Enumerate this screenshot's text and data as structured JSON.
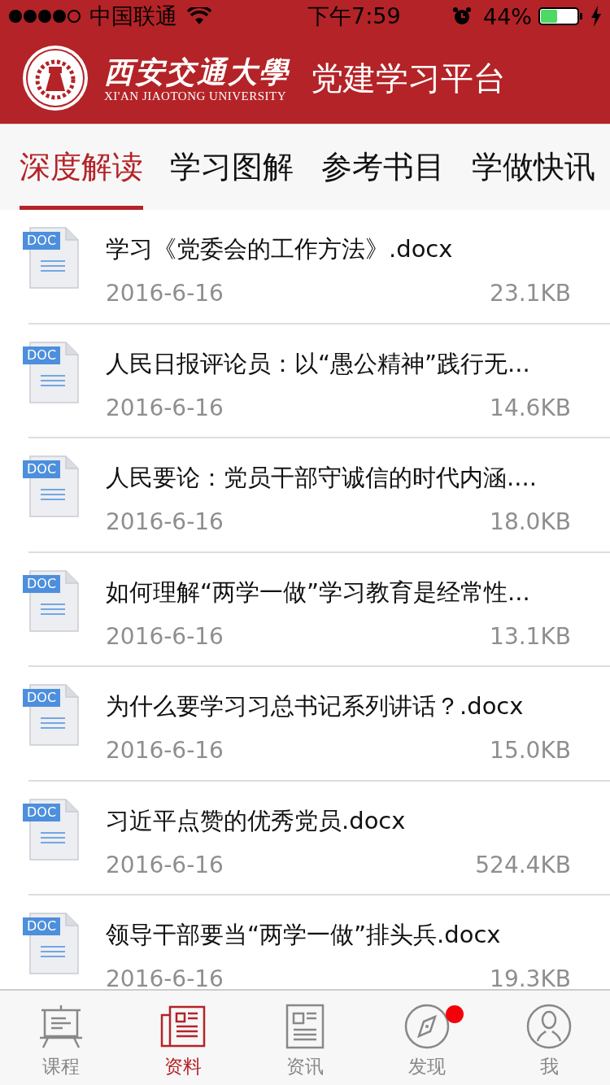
{
  "status_bar": {
    "carrier": "中国联通",
    "time": "下午7:59",
    "battery": "44%"
  },
  "header": {
    "logo_name": "西安交通大學",
    "logo_subtitle": "XI'AN JIAOTONG UNIVERSITY",
    "title": "党建学习平台"
  },
  "tabs": [
    {
      "label": "深度解读",
      "selected": true
    },
    {
      "label": "学习图解",
      "selected": false
    },
    {
      "label": "参考书目",
      "selected": false
    },
    {
      "label": "学做快讯",
      "selected": false
    }
  ],
  "files": [
    {
      "icon": "DOC",
      "name": "学习《党委会的工作方法》.docx",
      "date": "2016-6-16",
      "size": "23.1KB"
    },
    {
      "icon": "DOC",
      "name": "人民日报评论员：以“愚公精神”践行无...",
      "date": "2016-6-16",
      "size": "14.6KB"
    },
    {
      "icon": "DOC",
      "name": "人民要论：党员干部守诚信的时代内涵....",
      "date": "2016-6-16",
      "size": "18.0KB"
    },
    {
      "icon": "DOC",
      "name": "如何理解“两学一做”学习教育是经常性...",
      "date": "2016-6-16",
      "size": "13.1KB"
    },
    {
      "icon": "DOC",
      "name": "为什么要学习习总书记系列讲话？.docx",
      "date": "2016-6-16",
      "size": "15.0KB"
    },
    {
      "icon": "DOC",
      "name": "习近平点赞的优秀党员.docx",
      "date": "2016-6-16",
      "size": "524.4KB"
    },
    {
      "icon": "DOC",
      "name": "领导干部要当“两学一做”排头兵.docx",
      "date": "2016-6-16",
      "size": "19.3KB"
    }
  ],
  "tab_bar": [
    {
      "kind": "course",
      "label": "课程",
      "selected": false,
      "badge": false
    },
    {
      "kind": "materials",
      "label": "资料",
      "selected": true,
      "badge": false
    },
    {
      "kind": "news",
      "label": "资讯",
      "selected": false,
      "badge": false
    },
    {
      "kind": "discover",
      "label": "发现",
      "selected": false,
      "badge": true
    },
    {
      "kind": "me",
      "label": "我",
      "selected": false,
      "badge": false
    }
  ]
}
